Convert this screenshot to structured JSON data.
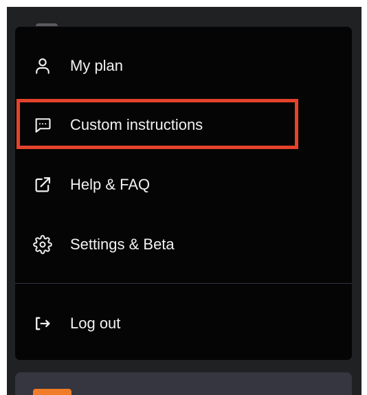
{
  "menu": {
    "items": [
      {
        "id": "my-plan",
        "label": "My plan",
        "icon": "user-icon"
      },
      {
        "id": "custom-instructions",
        "label": "Custom instructions",
        "icon": "message-square-icon",
        "highlighted": true
      },
      {
        "id": "help-faq",
        "label": "Help & FAQ",
        "icon": "external-link-icon"
      },
      {
        "id": "settings-beta",
        "label": "Settings & Beta",
        "icon": "gear-icon"
      },
      {
        "id": "log-out",
        "label": "Log out",
        "icon": "logout-icon"
      }
    ]
  },
  "colors": {
    "sidebar_bg": "#202123",
    "menu_bg": "#050505",
    "text": "#f2f2f2",
    "divider": "#343540",
    "highlight": "#e4432b",
    "account_bar": "#35363f",
    "avatar_accent": "#f07c29"
  }
}
